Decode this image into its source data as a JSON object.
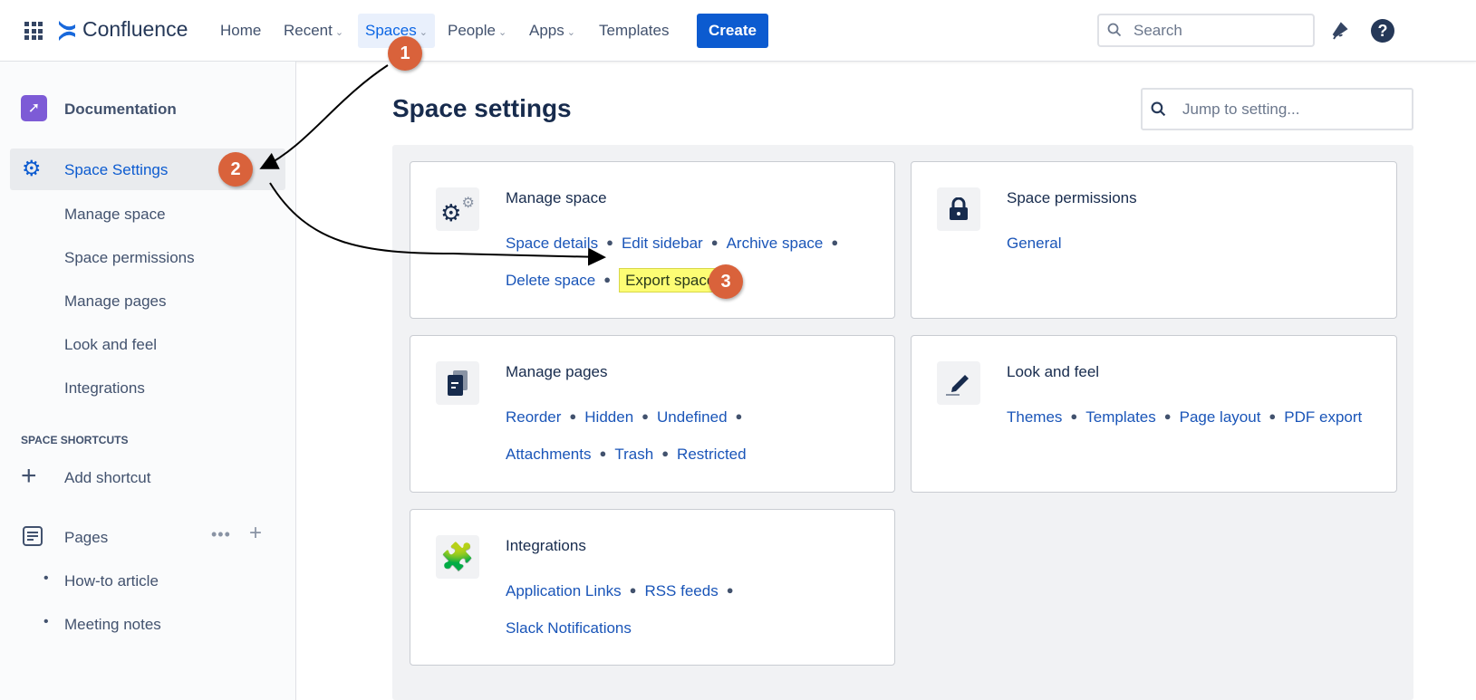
{
  "topbar": {
    "product": "Confluence",
    "nav": [
      {
        "label": "Home"
      },
      {
        "label": "Recent"
      },
      {
        "label": "Spaces"
      },
      {
        "label": "People"
      },
      {
        "label": "Apps"
      },
      {
        "label": "Templates"
      }
    ],
    "create": "Create",
    "search_placeholder": "Search"
  },
  "sidebar": {
    "space_name": "Documentation",
    "settings": "Space Settings",
    "items": [
      {
        "label": "Manage space"
      },
      {
        "label": "Space permissions"
      },
      {
        "label": "Manage pages"
      },
      {
        "label": "Look and feel"
      },
      {
        "label": "Integrations"
      }
    ],
    "shortcuts_heading": "SPACE SHORTCUTS",
    "add_shortcut": "Add shortcut",
    "pages": "Pages",
    "page_items": [
      {
        "label": "How-to article"
      },
      {
        "label": "Meeting notes"
      }
    ]
  },
  "main": {
    "title": "Space settings",
    "jump_placeholder": "Jump to setting...",
    "cards": [
      {
        "title": "Manage space",
        "links": [
          "Space details",
          "Edit sidebar",
          "Archive space",
          "Delete space",
          "Export space"
        ]
      },
      {
        "title": "Space permissions",
        "links": [
          "General"
        ]
      },
      {
        "title": "Manage pages",
        "links": [
          "Reorder",
          "Hidden",
          "Undefined",
          "Attachments",
          "Trash",
          "Restricted"
        ]
      },
      {
        "title": "Look and feel",
        "links": [
          "Themes",
          "Templates",
          "Page layout",
          "PDF export"
        ]
      },
      {
        "title": "Integrations",
        "links": [
          "Application Links",
          "RSS feeds",
          "Slack Notifications"
        ]
      }
    ]
  },
  "annotations": {
    "steps": [
      "1",
      "2",
      "3"
    ],
    "color": "#d9623b",
    "highlight": "#fdfd74"
  }
}
